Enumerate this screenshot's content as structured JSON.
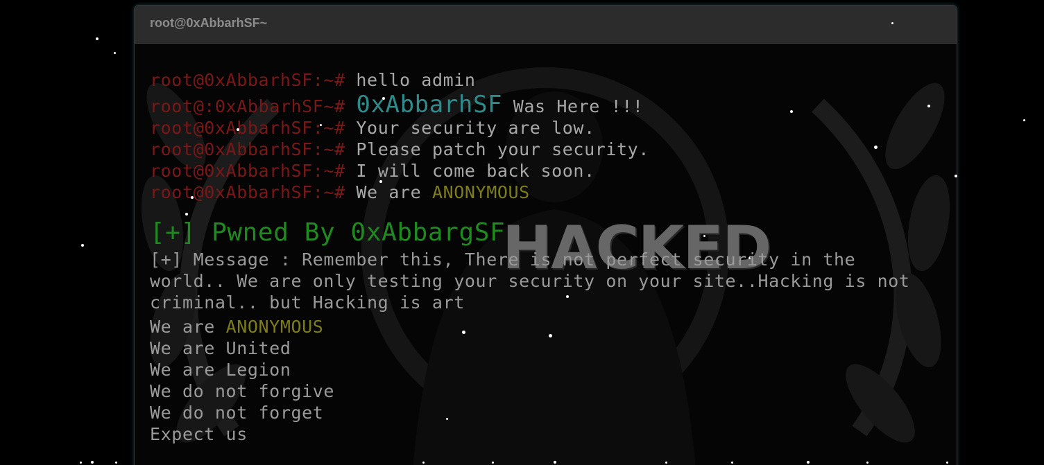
{
  "window": {
    "title": "root@0xAbbarhSF~"
  },
  "terminal": {
    "lines": [
      {
        "prompt": "root@0xAbbarhSF:~#",
        "text": "hello admin"
      },
      {
        "prompt": "root@:0xAbbarhSF~#",
        "brand": "0xAbbarhSF",
        "text": "Was Here !!!"
      },
      {
        "prompt": "root@0xAbbarhSF:~#",
        "text": "Your security are low."
      },
      {
        "prompt": "root@0xAbbarhSF:~#",
        "text": "Please patch your security."
      },
      {
        "prompt": "root@0xAbbarhSF:~#",
        "text": "I will come back soon."
      },
      {
        "prompt": "root@0xAbbarhSF:~#",
        "text": "We are",
        "highlight": "ANONYMOUS"
      }
    ],
    "pwned": "[+] Pwned By 0xAbbargSF",
    "message": "[+] Message : Remember this, There is not perfect security in the world.. We are only testing your security on your site..Hacking is not criminal.. but Hacking is art",
    "motto": [
      {
        "text": "We are",
        "highlight": "ANONYMOUS"
      },
      {
        "text": "We are United"
      },
      {
        "text": "We are Legion"
      },
      {
        "text": "We do not forgive"
      },
      {
        "text": "We do not forget"
      },
      {
        "text": "Expect us"
      }
    ]
  },
  "background": {
    "graphic": "anonymous-laurel-emblem",
    "overlay_text": "HACKED"
  },
  "colors": {
    "prompt": "#7a1818",
    "brand": "#2e8c8c",
    "highlight": "#7f7c1c",
    "pwned": "#1f8a1f",
    "text": "#9a9a9a"
  }
}
